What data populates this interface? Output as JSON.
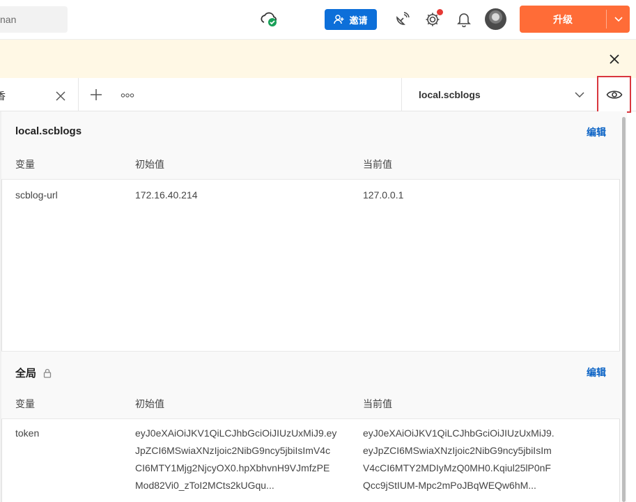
{
  "header": {
    "search_text": "nan",
    "invite_label": "邀请",
    "upgrade_label": "升级"
  },
  "tabs": {
    "active_label": "香"
  },
  "environment": {
    "selected": "local.scblogs"
  },
  "env_section": {
    "title": "local.scblogs",
    "edit_label": "编辑",
    "columns": [
      "变量",
      "初始值",
      "当前值"
    ],
    "rows": [
      {
        "variable": "scblog-url",
        "initial": "172.16.40.214",
        "current": "127.0.0.1"
      }
    ]
  },
  "global_section": {
    "title": "全局",
    "edit_label": "编辑",
    "columns": [
      "变量",
      "初始值",
      "当前值"
    ],
    "rows": [
      {
        "variable": "token",
        "initial_lines": [
          "eyJ0eXAiOiJKV1QiLCJhbGciOiJIUzUxMiJ9.ey",
          "JpZCI6MSwiaXNzIjoic2NibG9ncy5jbiIsImV4c",
          "CI6MTY1Mjg2NjcyOX0.hpXbhvnH9VJmfzPE",
          "Mod82Vi0_zToI2MCts2kUGqu..."
        ],
        "current_lines": [
          "eyJ0eXAiOiJKV1QiLCJhbGciOiJIUzUxMiJ9.",
          "eyJpZCI6MSwiaXNzIjoic2NibG9ncy5jbiIsIm",
          "V4cCI6MTY2MDIyMzQ0MH0.Kqiul25lP0nF",
          "Qcc9jStIUM-Mpc2mPoJBqWEQw6hM..."
        ]
      }
    ]
  },
  "colors": {
    "accent_orange": "#ff6c37",
    "invite_blue": "#0d6fd9",
    "link_blue": "#0b63c5",
    "banner_yellow": "#fff8e5",
    "highlight_red": "#d9363e"
  }
}
